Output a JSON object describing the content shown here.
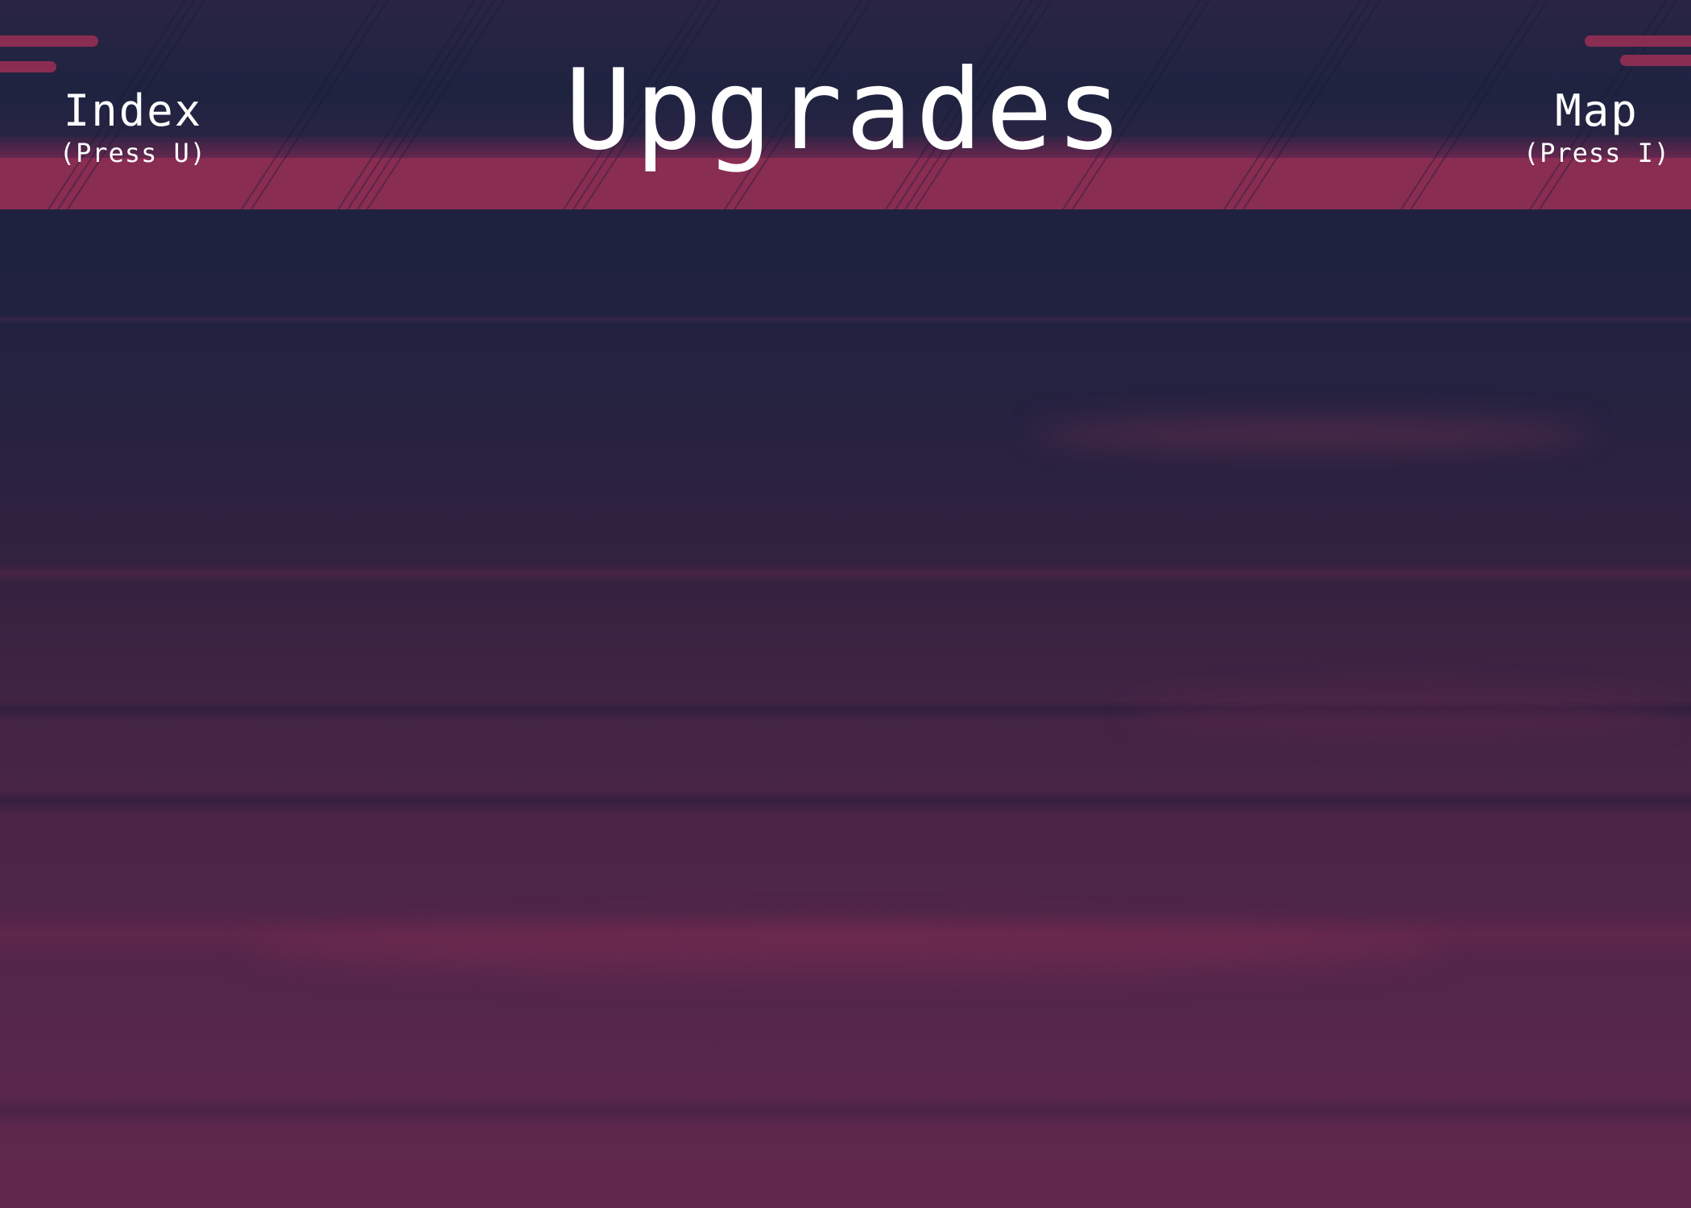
{
  "header": {
    "title": "Upgrades",
    "left_nav": {
      "label": "Index",
      "hint": "(Press U)"
    },
    "right_nav": {
      "label": "Map",
      "hint": "(Press I)"
    }
  },
  "colors": {
    "accent": "#8a2d52",
    "background_top": "#1c2340",
    "background_bottom": "#62274d",
    "text": "#ffffff"
  }
}
